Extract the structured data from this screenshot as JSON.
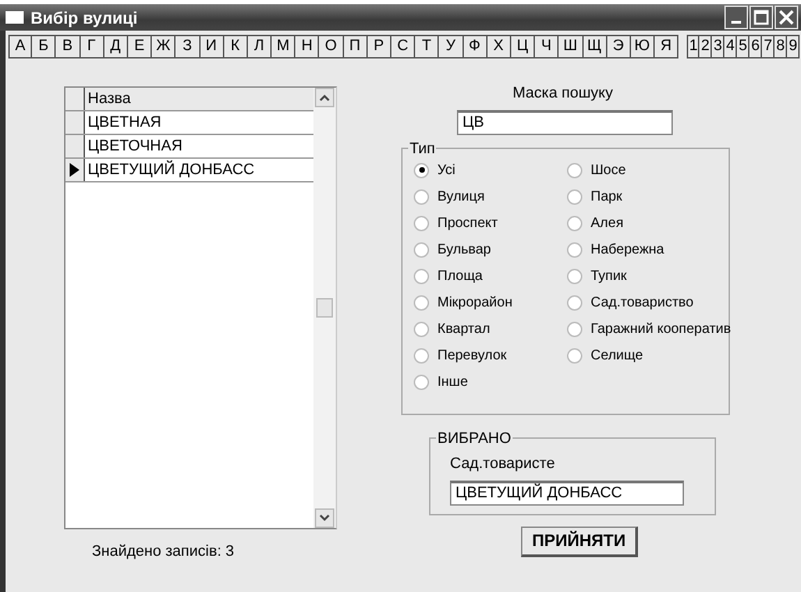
{
  "window": {
    "title": "Вибір вулиці"
  },
  "letters": [
    "А",
    "Б",
    "В",
    "Г",
    "Д",
    "Е",
    "Ж",
    "З",
    "И",
    "К",
    "Л",
    "М",
    "Н",
    "О",
    "П",
    "Р",
    "С",
    "Т",
    "У",
    "Ф",
    "Х",
    "Ц",
    "Ч",
    "Ш",
    "Щ",
    "Э",
    "Ю",
    "Я"
  ],
  "digits": [
    "1",
    "2",
    "3",
    "4",
    "5",
    "6",
    "7",
    "8",
    "9"
  ],
  "grid": {
    "columns": [
      "Назва"
    ],
    "rows": [
      {
        "name": "ЦВЕТНАЯ",
        "selected": false
      },
      {
        "name": "ЦВЕТОЧНАЯ",
        "selected": false
      },
      {
        "name": "ЦВЕТУЩИЙ ДОНБАСС",
        "selected": true
      }
    ]
  },
  "found_label": "Знайдено записів: 3",
  "search": {
    "label": "Маска пошуку",
    "value": "ЦВ"
  },
  "type_group": {
    "title": "Тип",
    "options_left": [
      {
        "label": "Усі",
        "selected": true
      },
      {
        "label": "Вулиця",
        "selected": false
      },
      {
        "label": "Проспект",
        "selected": false
      },
      {
        "label": "Бульвар",
        "selected": false
      },
      {
        "label": "Площа",
        "selected": false
      },
      {
        "label": "Мікрорайон",
        "selected": false
      },
      {
        "label": "Квартал",
        "selected": false
      },
      {
        "label": "Перевулок",
        "selected": false
      },
      {
        "label": "Інше",
        "selected": false
      }
    ],
    "options_right": [
      {
        "label": "Шосе",
        "selected": false
      },
      {
        "label": "Парк",
        "selected": false
      },
      {
        "label": "Алея",
        "selected": false
      },
      {
        "label": "Набережна",
        "selected": false
      },
      {
        "label": "Тупик",
        "selected": false
      },
      {
        "label": "Сад.товариство",
        "selected": false
      },
      {
        "label": "Гаражний кооператив",
        "selected": false
      },
      {
        "label": "Селище",
        "selected": false
      }
    ]
  },
  "selected_group": {
    "title": "ВИБРАНО",
    "type": "Сад.товаристе",
    "value": "ЦВЕТУЩИЙ ДОНБАСС"
  },
  "accept_button": "ПРИЙНЯТИ"
}
